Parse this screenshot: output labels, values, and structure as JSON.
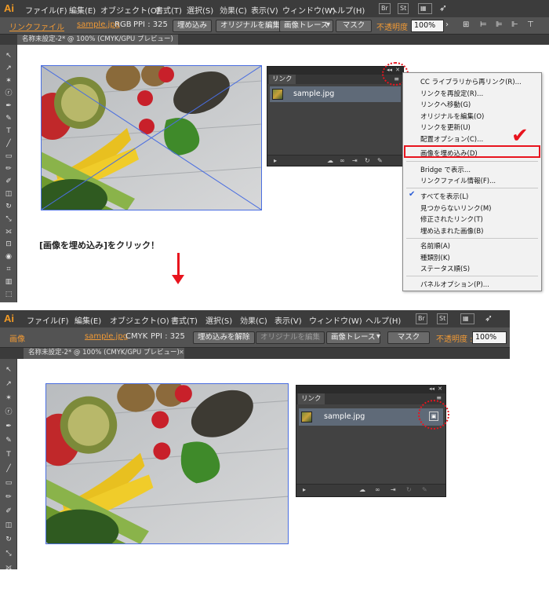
{
  "app": {
    "logo": "Ai"
  },
  "menu": [
    "ファイル(F)",
    "編集(E)",
    "オブジェクト(O)",
    "書式(T)",
    "選択(S)",
    "効果(C)",
    "表示(V)",
    "ウィンドウ(W)",
    "ヘルプ(H)"
  ],
  "menu_icons": [
    "Br",
    "St"
  ],
  "top": {
    "control_bar": {
      "label": "リンクファイル",
      "filename": "sample.jpg",
      "color_mode": "RGB",
      "ppi": "PPI : 325",
      "btn_embed": "埋め込み",
      "btn_edit_original": "オリジナルを編集",
      "btn_trace": "画像トレース",
      "btn_mask": "マスク",
      "opacity_label": "不透明度 :",
      "opacity_value": "100%"
    },
    "doc_tab": "名称未設定-2* @ 100% (CMYK/GPU プレビュー)",
    "links_panel": {
      "tab": "リンク",
      "file": "sample.jpg"
    },
    "context_menu": [
      "CC ライブラリから再リンク(R)...",
      "リンクを再設定(R)...",
      "リンクへ移動(G)",
      "オリジナルを編集(O)",
      "リンクを更新(U)",
      "配置オプション(C)...",
      "画像を埋め込み(D)",
      "Bridge で表示...",
      "リンクファイル情報(F)...",
      "すべてを表示(L)",
      "見つからないリンク(M)",
      "修正されたリンク(T)",
      "埋め込まれた画像(B)",
      "名前順(A)",
      "種類別(K)",
      "ステータス順(S)",
      "パネルオプション(P)..."
    ]
  },
  "instruction": "[画像を埋め込み]をクリック！",
  "bottom": {
    "control_bar": {
      "label": "画像",
      "filename": "sample.jpg",
      "color_mode": "CMYK",
      "ppi": "PPI : 325",
      "btn_unembed": "埋め込みを解除",
      "btn_edit_original": "オリジナルを編集",
      "btn_trace": "画像トレース",
      "btn_mask": "マスク",
      "opacity_label": "不透明度 :",
      "opacity_value": "100%"
    },
    "doc_tab": "名称未設定-2* @ 100% (CMYK/GPU プレビュー)",
    "links_panel": {
      "tab": "リンク",
      "file": "sample.jpg"
    }
  },
  "colors": {
    "accent_red": "#e8141e",
    "orange": "#f19a35",
    "selection_blue": "#4a6ee0"
  }
}
